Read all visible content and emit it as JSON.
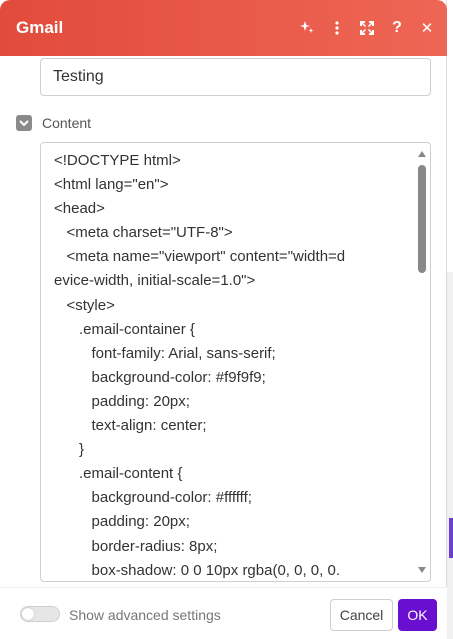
{
  "header": {
    "title": "Gmail",
    "color": "#e24b3b",
    "icons": [
      "ai-sparkle-icon",
      "more-vertical-icon",
      "expand-icon",
      "help-icon",
      "close-icon"
    ],
    "help_glyph": "?",
    "close_glyph": "✕"
  },
  "subject_field": {
    "value": "Testing"
  },
  "content_section": {
    "label": "Content"
  },
  "editor": {
    "lines": [
      "<!DOCTYPE html>",
      "<html lang=\"en\">",
      "<head>",
      "   <meta charset=\"UTF-8\">",
      "   <meta name=\"viewport\" content=\"width=d",
      "evice-width, initial-scale=1.0\">",
      "   <style>",
      "      .email-container {",
      "         font-family: Arial, sans-serif;",
      "         background-color: #f9f9f9;",
      "         padding: 20px;",
      "         text-align: center;",
      "      }",
      "      .email-content {",
      "         background-color: #ffffff;",
      "         padding: 20px;",
      "         border-radius: 8px;",
      "         box-shadow: 0 0 10px rgba(0, 0, 0, 0."
    ]
  },
  "footer": {
    "advanced_label": "Show advanced settings",
    "advanced_enabled": false,
    "cancel_label": "Cancel",
    "ok_label": "OK",
    "ok_color": "#6a0fd0"
  }
}
